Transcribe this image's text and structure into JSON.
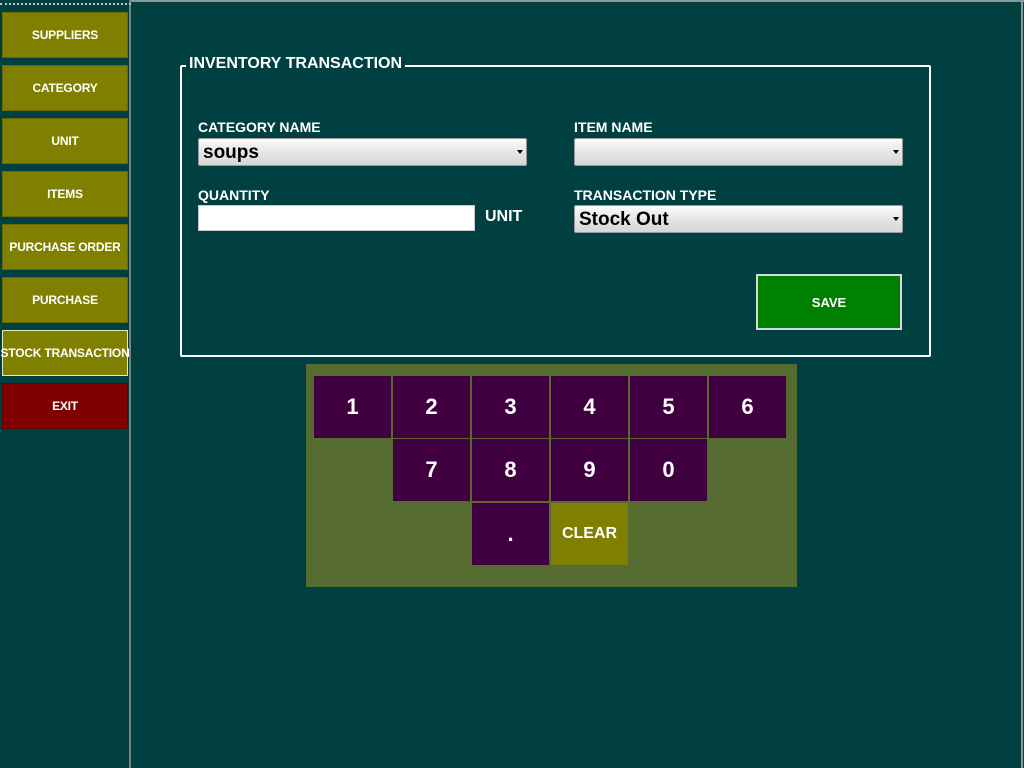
{
  "sidebar": {
    "items": [
      {
        "label": "SUPPLIERS"
      },
      {
        "label": "CATEGORY"
      },
      {
        "label": "UNIT"
      },
      {
        "label": "ITEMS"
      },
      {
        "label": "PURCHASE ORDER"
      },
      {
        "label": "PURCHASE"
      },
      {
        "label": "STOCK TRANSACTION"
      },
      {
        "label": "EXIT"
      }
    ]
  },
  "form": {
    "title": "INVENTORY TRANSACTION",
    "category_name": {
      "label": "CATEGORY NAME",
      "value": "soups"
    },
    "item_name": {
      "label": "ITEM NAME",
      "value": ""
    },
    "quantity": {
      "label": "QUANTITY",
      "value": "",
      "unit_label": "UNIT"
    },
    "transaction_type": {
      "label": "TRANSACTION TYPE",
      "value": "Stock Out"
    },
    "save_label": "SAVE"
  },
  "keypad": {
    "keys": [
      "1",
      "2",
      "3",
      "4",
      "5",
      "6",
      "7",
      "8",
      "9",
      "0",
      ".",
      "CLEAR"
    ]
  },
  "colors": {
    "background": "#004040",
    "nav_button": "#808000",
    "exit_button": "#800000",
    "save_button": "#008000",
    "keypad_background": "#556b2f",
    "key": "#400040"
  }
}
